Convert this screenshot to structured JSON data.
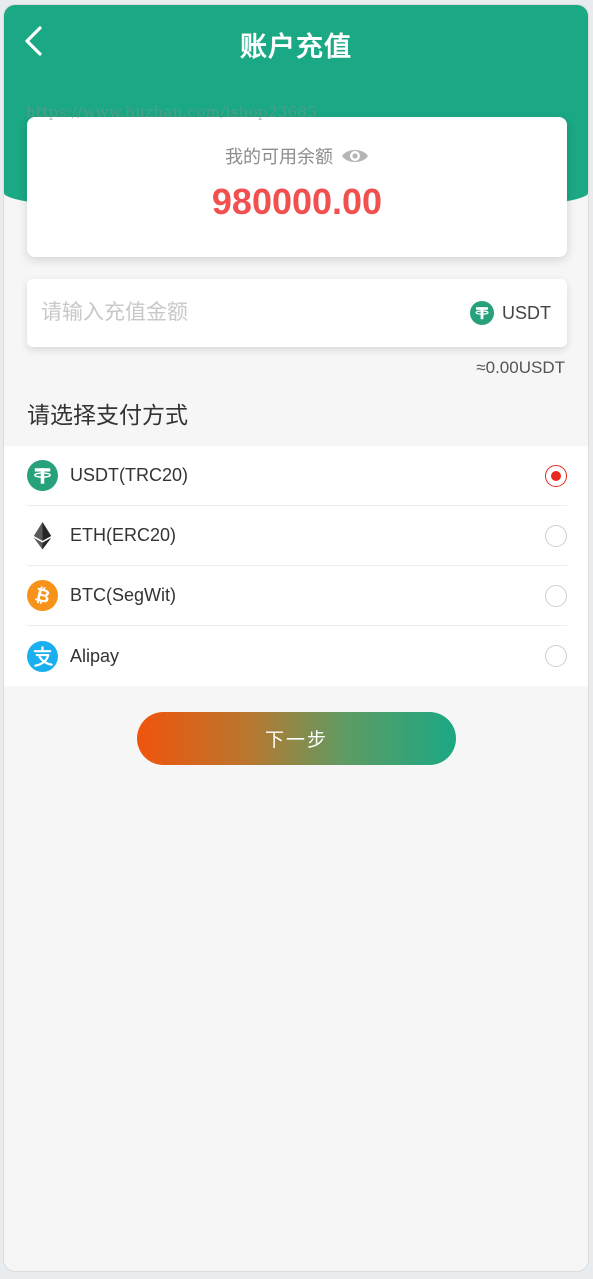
{
  "header": {
    "title": "账户充值"
  },
  "watermark": "https://www.huzhan.com/ishop23685",
  "balance": {
    "label": "我的可用余额",
    "value": "980000.00"
  },
  "amount": {
    "placeholder": "请输入充值金额",
    "value": "",
    "currency": "USDT",
    "converted": "≈0.00USDT"
  },
  "payment": {
    "title": "请选择支付方式",
    "methods": [
      {
        "label": "USDT(TRC20)",
        "icon": "tether-icon",
        "selected": true
      },
      {
        "label": "ETH(ERC20)",
        "icon": "ethereum-icon",
        "selected": false
      },
      {
        "label": "BTC(SegWit)",
        "icon": "bitcoin-icon",
        "selected": false
      },
      {
        "label": "Alipay",
        "icon": "alipay-icon",
        "selected": false
      }
    ]
  },
  "next_button": {
    "label": "下一步"
  },
  "colors": {
    "primary": "#1ba884",
    "balance": "#f2504f",
    "radio_selected": "#e62b1e",
    "btn_start": "#f0540c"
  }
}
